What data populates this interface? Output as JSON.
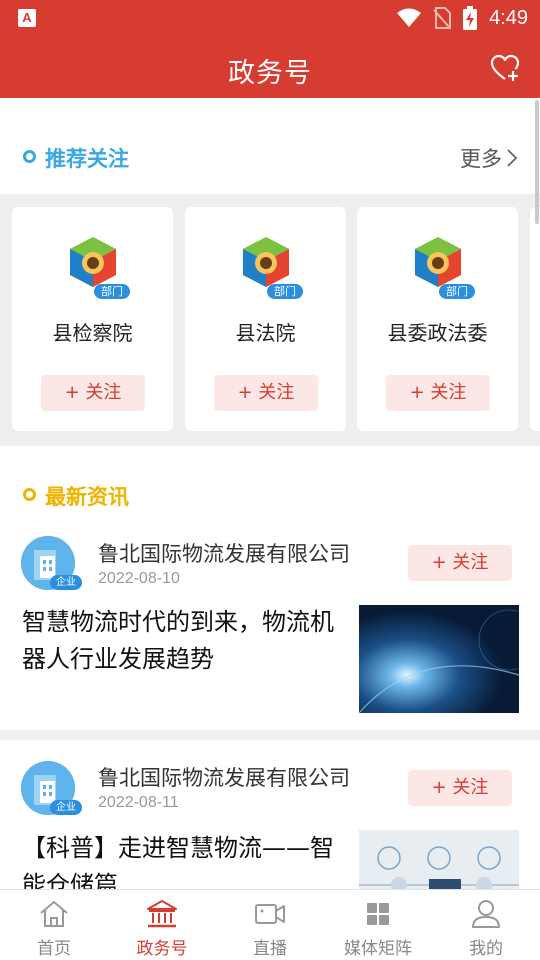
{
  "status_bar": {
    "time": "4:49",
    "app_badge": "A"
  },
  "header": {
    "title": "政务号"
  },
  "recommend": {
    "title": "推荐关注",
    "more_label": "更多",
    "cards": [
      {
        "name": "县检察院",
        "badge": "部门",
        "follow_label": "+ 关注"
      },
      {
        "name": "县法院",
        "badge": "部门",
        "follow_label": "+ 关注"
      },
      {
        "name": "县委政法委",
        "badge": "部门",
        "follow_label": "+ 关注"
      }
    ]
  },
  "news": {
    "title": "最新资讯",
    "items": [
      {
        "publisher": "鲁北国际物流发展有限公司",
        "badge": "企业",
        "date": "2022-08-10",
        "follow_label": "+ 关注",
        "headline": "智慧物流时代的到来，物流机器人行业发展趋势"
      },
      {
        "publisher": "鲁北国际物流发展有限公司",
        "badge": "企业",
        "date": "2022-08-11",
        "follow_label": "+ 关注",
        "headline": "【科普】走进智慧物流——智能仓储篇"
      }
    ]
  },
  "bottom_nav": [
    {
      "label": "首页",
      "icon": "home-icon",
      "active": false
    },
    {
      "label": "政务号",
      "icon": "government-building-icon",
      "active": true
    },
    {
      "label": "直播",
      "icon": "video-camera-icon",
      "active": false
    },
    {
      "label": "媒体矩阵",
      "icon": "grid-icon",
      "active": false
    },
    {
      "label": "我的",
      "icon": "user-icon",
      "active": false
    }
  ],
  "colors": {
    "brand_red": "#d63c2f",
    "recommend_blue": "#39a7e4",
    "news_yellow": "#f0b400",
    "badge_blue": "#2b8fe0"
  }
}
